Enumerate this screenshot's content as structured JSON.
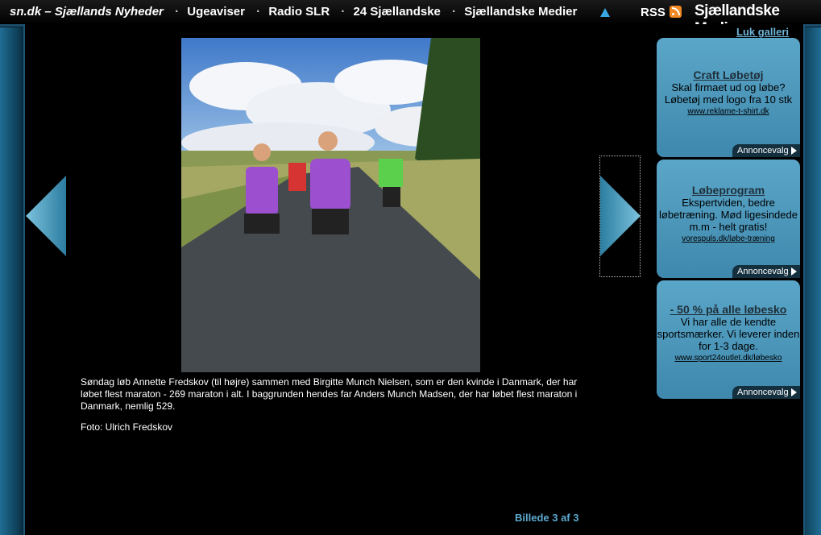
{
  "topbar": {
    "brand": "sn.dk – Sjællands Nyheder",
    "nav": [
      "Ugeaviser",
      "Radio SLR",
      "24 Sjællandske",
      "Sjællandske Medier"
    ],
    "rss_label": "RSS",
    "logo": "Sjællandske Medier",
    "icons": [
      "warning-icon",
      "rss-icon"
    ]
  },
  "gallery": {
    "close_label": "Luk galleri",
    "caption": "Søndag løb Annette Fredskov (til højre) sammen med Birgitte Munch Nielsen, som er den kvinde i Danmark, der har løbet flest maraton - 269 maraton i alt. I baggrunden hendes far Anders Munch Madsen, der har løbet flest maraton i Danmark, nemlig 529.",
    "credit": "Foto: Ulrich Fredskov",
    "counter": "Billede 3 af 3"
  },
  "ads": [
    {
      "title": "Craft Løbetøj",
      "text": "Skal firmaet ud og løbe? Løbetøj med logo fra 10 stk",
      "url": "www.reklame-t-shirt.dk",
      "choice": "Annoncevalg"
    },
    {
      "title": "Løbeprogram",
      "text": "Ekspertviden, bedre løbetræning. Mød ligesindede m.m - helt gratis!",
      "url": "vorespuls.dk/løbe-træning",
      "choice": "Annoncevalg"
    },
    {
      "title": "- 50 % på alle løbesko",
      "text": "Vi har alle de kendte sportsmærker. Vi leverer inden for 1-3 dage.",
      "url": "www.sport24outlet.dk/løbesko",
      "choice": "Annoncevalg"
    }
  ],
  "colors": {
    "accent": "#3e97b8",
    "link": "#6fb4d8",
    "ad_bg": "#5aa6c8"
  }
}
